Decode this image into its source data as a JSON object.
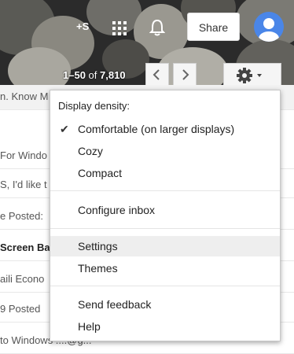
{
  "topbar": {
    "plus_label": "+S",
    "share_label": "Share"
  },
  "pager": {
    "range": "1–50",
    "of": "of",
    "total": "7,810"
  },
  "email_rows": [
    {
      "text": "n. Know M"
    },
    {
      "text": "For Windo"
    },
    {
      "text": "S, I'd like t"
    },
    {
      "text": "e Posted:"
    },
    {
      "text": "Screen Ba"
    },
    {
      "text": "aili Econo"
    },
    {
      "text": "9 Posted"
    },
    {
      "text": "to Windows   ....@g..."
    }
  ],
  "menu": {
    "heading": "Display density:",
    "density_options": [
      {
        "label": "Comfortable (on larger displays)",
        "checked": true
      },
      {
        "label": "Cozy",
        "checked": false
      },
      {
        "label": "Compact",
        "checked": false
      }
    ],
    "configure_inbox": "Configure inbox",
    "settings": "Settings",
    "themes": "Themes",
    "send_feedback": "Send feedback",
    "help": "Help"
  }
}
